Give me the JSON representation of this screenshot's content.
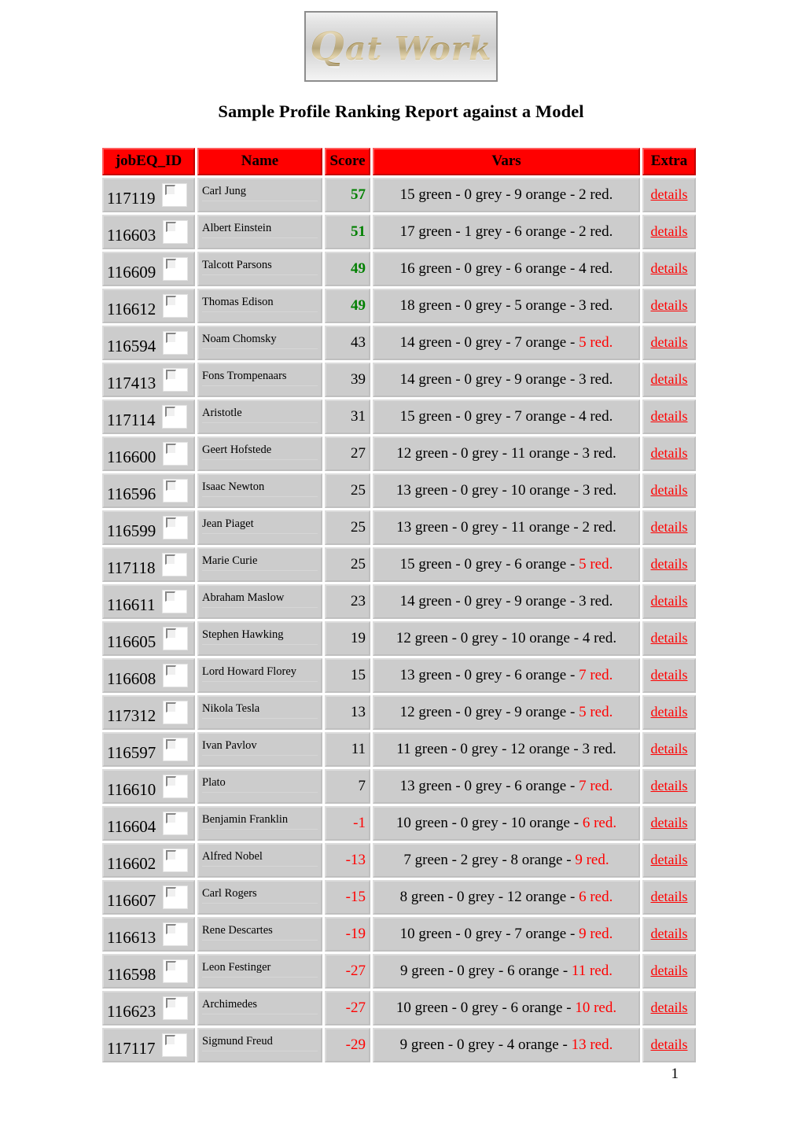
{
  "logo": {
    "alt": "Q at Work",
    "q": "Q",
    "rest": "at Work"
  },
  "title": "Sample Profile Ranking Report against a Model",
  "table": {
    "headers": [
      "jobEQ_ID",
      "Name",
      "Score",
      "Vars",
      "Extra"
    ],
    "details_label": "details",
    "colors": {
      "header_bg": "#ff0000",
      "cell_bg": "#cccccc",
      "score_high": "#008000",
      "score_negative": "#ff0000",
      "link": "#ff0000"
    },
    "rows": [
      {
        "id": "117119",
        "name": "Carl Jung",
        "score": "57",
        "score_style": "high",
        "vars_black": "15 green - 0 grey - 9 orange - ",
        "vars_red": "2 red.",
        "red_colored": false
      },
      {
        "id": "116603",
        "name": "Albert Einstein",
        "score": "51",
        "score_style": "high",
        "vars_black": "17 green - 1 grey - 6 orange - ",
        "vars_red": "2 red.",
        "red_colored": false
      },
      {
        "id": "116609",
        "name": "Talcott Parsons",
        "score": "49",
        "score_style": "high",
        "vars_black": "16 green - 0 grey - 6 orange - ",
        "vars_red": "4 red.",
        "red_colored": false
      },
      {
        "id": "116612",
        "name": "Thomas Edison",
        "score": "49",
        "score_style": "high",
        "vars_black": "18 green - 0 grey - 5 orange - ",
        "vars_red": "3 red.",
        "red_colored": false
      },
      {
        "id": "116594",
        "name": "Noam Chomsky",
        "score": "43",
        "score_style": "normal",
        "vars_black": "14 green - 0 grey - 7 orange - ",
        "vars_red": "5 red.",
        "red_colored": true
      },
      {
        "id": "117413",
        "name": "Fons Trompenaars",
        "score": "39",
        "score_style": "normal",
        "vars_black": "14 green - 0 grey - 9 orange - ",
        "vars_red": "3 red.",
        "red_colored": false
      },
      {
        "id": "117114",
        "name": "Aristotle",
        "score": "31",
        "score_style": "normal",
        "vars_black": "15 green - 0 grey - 7 orange - ",
        "vars_red": "4 red.",
        "red_colored": false
      },
      {
        "id": "116600",
        "name": "Geert Hofstede",
        "score": "27",
        "score_style": "normal",
        "vars_black": "12 green - 0 grey - 11 orange - ",
        "vars_red": "3 red.",
        "red_colored": false
      },
      {
        "id": "116596",
        "name": "Isaac Newton",
        "score": "25",
        "score_style": "normal",
        "vars_black": "13 green - 0 grey - 10 orange - ",
        "vars_red": "3 red.",
        "red_colored": false
      },
      {
        "id": "116599",
        "name": "Jean Piaget",
        "score": "25",
        "score_style": "normal",
        "vars_black": "13 green - 0 grey - 11 orange - ",
        "vars_red": "2 red.",
        "red_colored": false
      },
      {
        "id": "117118",
        "name": "Marie Curie",
        "score": "25",
        "score_style": "normal",
        "vars_black": "15 green - 0 grey - 6 orange - ",
        "vars_red": "5 red.",
        "red_colored": true
      },
      {
        "id": "116611",
        "name": "Abraham Maslow",
        "score": "23",
        "score_style": "normal",
        "vars_black": "14 green - 0 grey - 9 orange - ",
        "vars_red": "3 red.",
        "red_colored": false
      },
      {
        "id": "116605",
        "name": "Stephen Hawking",
        "score": "19",
        "score_style": "normal",
        "vars_black": "12 green - 0 grey - 10 orange - ",
        "vars_red": "4 red.",
        "red_colored": false
      },
      {
        "id": "116608",
        "name": "Lord Howard Florey",
        "score": "15",
        "score_style": "normal",
        "vars_black": "13 green - 0 grey - 6 orange - ",
        "vars_red": "7 red.",
        "red_colored": true
      },
      {
        "id": "117312",
        "name": "Nikola Tesla",
        "score": "13",
        "score_style": "normal",
        "vars_black": "12 green - 0 grey - 9 orange - ",
        "vars_red": "5 red.",
        "red_colored": true
      },
      {
        "id": "116597",
        "name": "Ivan Pavlov",
        "score": "11",
        "score_style": "normal",
        "vars_black": "11 green - 0 grey - 12 orange - ",
        "vars_red": "3 red.",
        "red_colored": false
      },
      {
        "id": "116610",
        "name": "Plato",
        "score": "7",
        "score_style": "normal",
        "vars_black": "13 green - 0 grey - 6 orange - ",
        "vars_red": "7 red.",
        "red_colored": true
      },
      {
        "id": "116604",
        "name": "Benjamin Franklin",
        "score": "-1",
        "score_style": "negative",
        "vars_black": "10 green - 0 grey - 10 orange - ",
        "vars_red": "6 red.",
        "red_colored": true
      },
      {
        "id": "116602",
        "name": "Alfred Nobel",
        "score": "-13",
        "score_style": "negative",
        "vars_black": "7 green - 2 grey - 8 orange - ",
        "vars_red": "9 red.",
        "red_colored": true
      },
      {
        "id": "116607",
        "name": "Carl Rogers",
        "score": "-15",
        "score_style": "negative",
        "vars_black": "8 green - 0 grey - 12 orange - ",
        "vars_red": "6 red.",
        "red_colored": true
      },
      {
        "id": "116613",
        "name": "Rene Descartes",
        "score": "-19",
        "score_style": "negative",
        "vars_black": "10 green - 0 grey - 7 orange - ",
        "vars_red": "9 red.",
        "red_colored": true
      },
      {
        "id": "116598",
        "name": "Leon Festinger",
        "score": "-27",
        "score_style": "negative",
        "vars_black": "9 green - 0 grey - 6 orange - ",
        "vars_red": "11 red.",
        "red_colored": true
      },
      {
        "id": "116623",
        "name": "Archimedes",
        "score": "-27",
        "score_style": "negative",
        "vars_black": "10 green - 0 grey - 6 orange - ",
        "vars_red": "10 red.",
        "red_colored": true
      },
      {
        "id": "117117",
        "name": "Sigmund Freud",
        "score": "-29",
        "score_style": "negative",
        "vars_black": "9 green - 0 grey - 4 orange - ",
        "vars_red": "13 red.",
        "red_colored": true
      }
    ]
  },
  "footer": {
    "page_number": "1"
  }
}
